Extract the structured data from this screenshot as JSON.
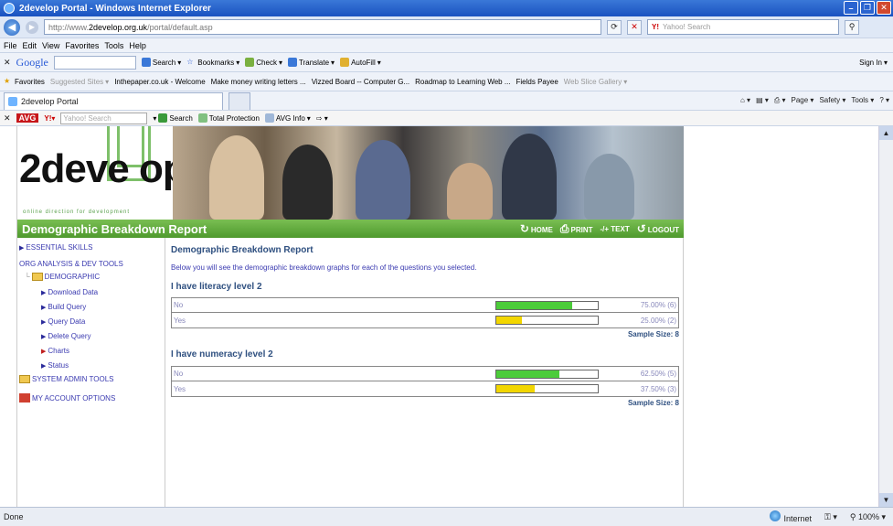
{
  "window": {
    "title": "2develop Portal - Windows Internet Explorer"
  },
  "address": {
    "url_prefix": "http://www.",
    "url_domain": "2develop.org.uk",
    "url_path": "/portal/default.asp",
    "search_placeholder": "Yahoo! Search"
  },
  "menu": [
    "File",
    "Edit",
    "View",
    "Favorites",
    "Tools",
    "Help"
  ],
  "google_bar": {
    "logo": "Google",
    "items": [
      "Search",
      "Bookmarks",
      "Check",
      "Translate",
      "AutoFill"
    ],
    "signin": "Sign In"
  },
  "favorites_bar": {
    "label": "Favorites",
    "items": [
      "Suggested Sites",
      "Inthepaper.co.uk - Welcome",
      "Make money writing letters ...",
      "Vizzed Board -- Computer G...",
      "Roadmap to Learning Web ...",
      "Fields Payee",
      "Web Slice Gallery"
    ]
  },
  "tab": {
    "title": "2develop Portal"
  },
  "commands": [
    "Page",
    "Safety",
    "Tools"
  ],
  "avg_bar": {
    "logo": "AVG",
    "search_placeholder": "Yahoo! Search",
    "search": "Search",
    "protection": "Total Protection",
    "info": "AVG Info"
  },
  "site": {
    "logo": "2deve op",
    "tagline": "online direction for development",
    "page_title": "Demographic Breakdown Report",
    "links": {
      "home": "HOME",
      "print": "PRINT",
      "text": "-/+ TEXT",
      "logout": "LOGOUT"
    }
  },
  "sidebar": {
    "essential": "ESSENTIAL SKILLS",
    "org": "ORG ANALYSIS & DEV TOOLS",
    "demographic": "DEMOGRAPHIC",
    "items": [
      "Download Data",
      "Build Query",
      "Query Data",
      "Delete Query",
      "Charts",
      "Status"
    ],
    "system": "SYSTEM ADMIN TOOLS",
    "account": "MY ACCOUNT OPTIONS"
  },
  "report": {
    "heading": "Demographic Breakdown Report",
    "intro": "Below you will see the demographic breakdown graphs for each of the questions you selected.",
    "questions": [
      {
        "title": "I have literacy level 2",
        "rows": [
          {
            "label": "No",
            "value": "75.00% (6)",
            "fraction": 0.75,
            "color": "#4ccc3a"
          },
          {
            "label": "Yes",
            "value": "25.00% (2)",
            "fraction": 0.25,
            "color": "#f2d600"
          }
        ],
        "sample": "Sample Size: 8"
      },
      {
        "title": "I have numeracy level 2",
        "rows": [
          {
            "label": "No",
            "value": "62.50% (5)",
            "fraction": 0.625,
            "color": "#4ccc3a"
          },
          {
            "label": "Yes",
            "value": "37.50% (3)",
            "fraction": 0.375,
            "color": "#f2d600"
          }
        ],
        "sample": "Sample Size: 8"
      }
    ]
  },
  "status": {
    "left": "Done",
    "zone": "Internet",
    "zoom": "100%"
  }
}
